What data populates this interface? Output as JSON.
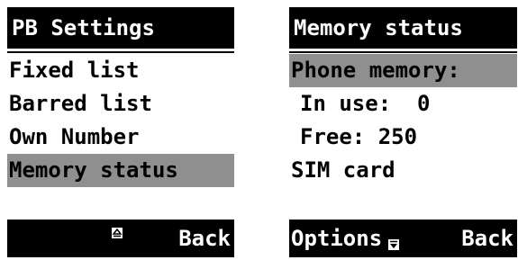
{
  "left_screen": {
    "title": "PB Settings",
    "items": [
      {
        "label": "Fixed list"
      },
      {
        "label": "Barred list"
      },
      {
        "label": "Own Number"
      },
      {
        "label": "Memory status"
      }
    ],
    "selected_index": 3,
    "softkeys": {
      "left": "",
      "right": "Back",
      "nav_icon": "up-arrow-icon"
    }
  },
  "right_screen": {
    "title": "Memory status",
    "rows": [
      {
        "label": "Phone memory:"
      },
      {
        "label": "In use:  0"
      },
      {
        "label": "Free: 250"
      },
      {
        "label": "SIM card"
      }
    ],
    "selected_index": 0,
    "softkeys": {
      "left": "Options",
      "right": "Back",
      "nav_icon": "down-arrow-icon"
    }
  },
  "colors": {
    "bar": "#000000",
    "highlight": "#8f8f8f",
    "background": "#ffffff"
  }
}
